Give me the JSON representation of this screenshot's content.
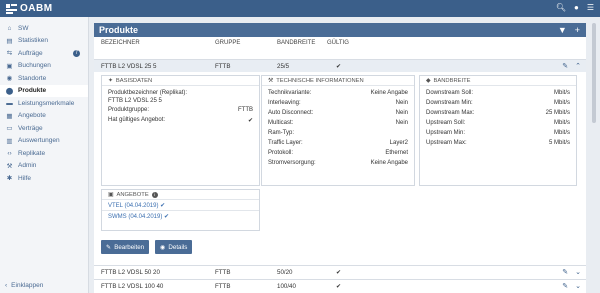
{
  "app": {
    "logo_text": "OABM"
  },
  "sidebar": {
    "items": [
      {
        "label": "SW",
        "icon": "home-icon",
        "glyph": "⌂"
      },
      {
        "label": "Statistiken",
        "icon": "chart-icon",
        "glyph": "▤"
      },
      {
        "label": "Aufträge",
        "icon": "cart-icon",
        "glyph": "⇆",
        "badge": "7"
      },
      {
        "label": "Buchungen",
        "icon": "bookings-icon",
        "glyph": "▣"
      },
      {
        "label": "Standorte",
        "icon": "location-icon",
        "glyph": "◉"
      },
      {
        "label": "Produkte",
        "icon": "products-icon",
        "glyph": "⬤",
        "active": true
      },
      {
        "label": "Leistungsmerkmale",
        "icon": "features-icon",
        "glyph": "▬"
      },
      {
        "label": "Angebote",
        "icon": "offers-icon",
        "glyph": "▦"
      },
      {
        "label": "Verträge",
        "icon": "contracts-icon",
        "glyph": "▭"
      },
      {
        "label": "Auswertungen",
        "icon": "reports-icon",
        "glyph": "▥"
      },
      {
        "label": "Replikate",
        "icon": "code-icon",
        "glyph": "‹›"
      },
      {
        "label": "Admin",
        "icon": "wrench-icon",
        "glyph": "⚒"
      },
      {
        "label": "Hilfe",
        "icon": "help-icon",
        "glyph": "✱"
      }
    ],
    "collapse_label": "Einklappen"
  },
  "panel": {
    "title": "Produkte"
  },
  "table": {
    "headers": {
      "name": "BEZEICHNER",
      "group": "GRUPPE",
      "bandwidth": "BANDBREITE",
      "valid": "GÜLTIG"
    },
    "rows": [
      {
        "name": "FTTB L2 VDSL 25 5",
        "group": "FTTB",
        "bandwidth": "25/5",
        "valid": "✔"
      },
      {
        "name": "FTTB L2 VDSL 50 20",
        "group": "FTTB",
        "bandwidth": "50/20",
        "valid": "✔"
      },
      {
        "name": "FTTB L2 VDSL 100 40",
        "group": "FTTB",
        "bandwidth": "100/40",
        "valid": "✔"
      }
    ]
  },
  "detail": {
    "basis": {
      "title": "BASISDATEN",
      "replica_label": "Produktbezeichner (Replikat):",
      "replica_value": "FTTB L2 VDSL 25 5",
      "group_label": "Produktgruppe:",
      "group_value": "FTTB",
      "valid_label": "Hat gültiges Angebot:",
      "valid_value": "✔"
    },
    "tech": {
      "title": "TECHNISCHE INFORMATIONEN",
      "items": [
        {
          "k": "Technikvariante:",
          "v": "Keine Angabe"
        },
        {
          "k": "Interleaving:",
          "v": "Nein"
        },
        {
          "k": "Auto Disconnect:",
          "v": "Nein"
        },
        {
          "k": "Multicast:",
          "v": "Nein"
        },
        {
          "k": "Ram-Typ:",
          "v": ""
        },
        {
          "k": "Traffic Layer:",
          "v": "Layer2"
        },
        {
          "k": "Protokoll:",
          "v": "Ethernet"
        },
        {
          "k": "Stromversorgung:",
          "v": "Keine Angabe"
        }
      ]
    },
    "bandwidth": {
      "title": "BANDBREITE",
      "items": [
        {
          "k": "Downstream Soll:",
          "v": "Mbit/s"
        },
        {
          "k": "Downstream Min:",
          "v": "Mbit/s"
        },
        {
          "k": "Downstream Max:",
          "v": "25 Mbit/s"
        },
        {
          "k": "Upstream Soll:",
          "v": "Mbit/s"
        },
        {
          "k": "Upstream Min:",
          "v": "Mbit/s"
        },
        {
          "k": "Upstream Max:",
          "v": "5 Mbit/s"
        }
      ]
    },
    "offers": {
      "title": "ANGEBOTE",
      "items": [
        {
          "label": "VTEL (04.04.2019) ✔"
        },
        {
          "label": "SWMS (04.04.2019) ✔"
        }
      ]
    },
    "buttons": {
      "edit": "Bearbeiten",
      "details": "Details"
    }
  }
}
